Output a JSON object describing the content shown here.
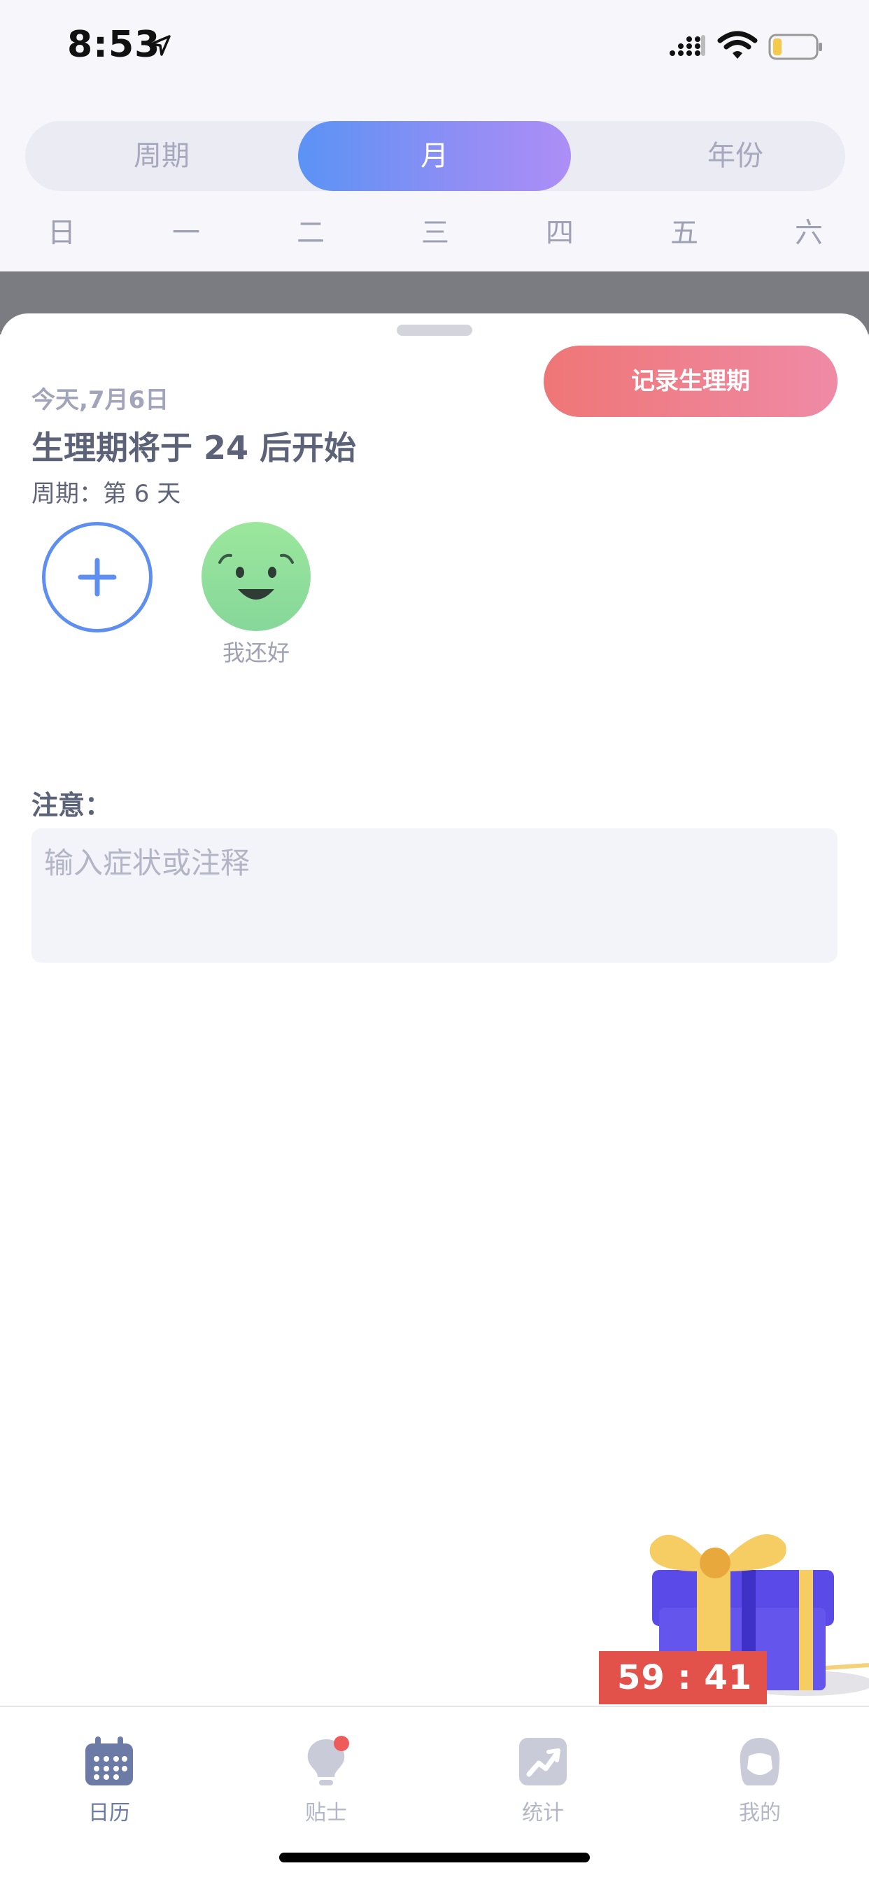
{
  "status_bar": {
    "time": "8:53",
    "icons": [
      "location-arrow-icon",
      "cellular-signal-icon",
      "wifi-icon",
      "battery-icon"
    ],
    "battery_color": "#f5c94a"
  },
  "segment": {
    "items": [
      "周期",
      "月",
      "年份"
    ],
    "selected": "月",
    "selected_gradient": [
      "#5b93f5",
      "#ad8ef6"
    ]
  },
  "weekdays": [
    "日",
    "一",
    "二",
    "三",
    "四",
    "五",
    "六"
  ],
  "sheet": {
    "record_button": "记录生理期",
    "date_text": "今天,7月6日",
    "headline": "生理期将于 24 后开始",
    "cycle_text": "周期：第 6 天",
    "add_icon": "plus-icon",
    "mood": {
      "icon": "smiley-face-icon",
      "label": "我还好",
      "color": "#8fdc9a"
    },
    "note_label": "注意：",
    "note_placeholder": "输入症状或注释",
    "note_value": ""
  },
  "promo": {
    "icon": "gift-box-icon",
    "countdown": "59 : 41",
    "tag_color": "#e2524b"
  },
  "tabbar": {
    "tabs": [
      {
        "label": "日历",
        "icon": "calendar-icon",
        "active": true
      },
      {
        "label": "贴士",
        "icon": "lightbulb-icon",
        "active": false,
        "badge": true
      },
      {
        "label": "统计",
        "icon": "trend-chart-icon",
        "active": false
      },
      {
        "label": "我的",
        "icon": "profile-avatar-icon",
        "active": false
      }
    ],
    "active_color": "#6c7aa6",
    "inactive_color": "#b3b6c6",
    "badge_color": "#ef5b5b"
  }
}
